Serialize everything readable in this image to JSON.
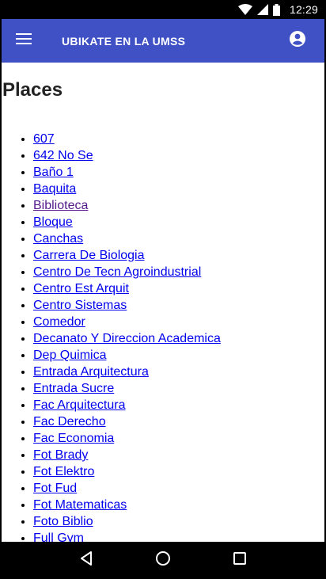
{
  "status_bar": {
    "time": "12:29",
    "icons": [
      "wifi-icon",
      "signal-icon",
      "battery-icon"
    ]
  },
  "app_bar": {
    "title": "UBIKATE EN LA UMSS",
    "menu_icon": "menu-icon",
    "account_icon": "account-circle-icon",
    "color": "#3f51c4"
  },
  "main": {
    "title": "Places",
    "places": [
      {
        "label": "607",
        "visited": false
      },
      {
        "label": "642 No Se",
        "visited": false
      },
      {
        "label": "Baño 1",
        "visited": false
      },
      {
        "label": "Baquita",
        "visited": false
      },
      {
        "label": "Biblioteca",
        "visited": true
      },
      {
        "label": "Bloque",
        "visited": false
      },
      {
        "label": "Canchas",
        "visited": false
      },
      {
        "label": "Carrera De Biologia",
        "visited": false
      },
      {
        "label": "Centro De Tecn Agroindustrial",
        "visited": false
      },
      {
        "label": "Centro Est Arquit",
        "visited": false
      },
      {
        "label": "Centro Sistemas",
        "visited": false
      },
      {
        "label": "Comedor",
        "visited": false
      },
      {
        "label": "Decanato Y Direccion Academica",
        "visited": false
      },
      {
        "label": "Dep Quimica",
        "visited": false
      },
      {
        "label": "Entrada Arquitectura",
        "visited": false
      },
      {
        "label": "Entrada Sucre",
        "visited": false
      },
      {
        "label": "Fac Arquitectura",
        "visited": false
      },
      {
        "label": "Fac Derecho",
        "visited": false
      },
      {
        "label": "Fac Economia",
        "visited": false
      },
      {
        "label": "Fot Brady",
        "visited": false
      },
      {
        "label": "Fot Elektro",
        "visited": false
      },
      {
        "label": "Fot Fud",
        "visited": false
      },
      {
        "label": "Fot Matematicas",
        "visited": false
      },
      {
        "label": "Foto Biblio",
        "visited": false
      },
      {
        "label": "Full Gym",
        "visited": false
      }
    ],
    "link_color": "#0000ee",
    "visited_color": "#551a8b"
  },
  "nav_bar": {
    "buttons": [
      "back-icon",
      "home-icon",
      "recents-icon"
    ]
  }
}
